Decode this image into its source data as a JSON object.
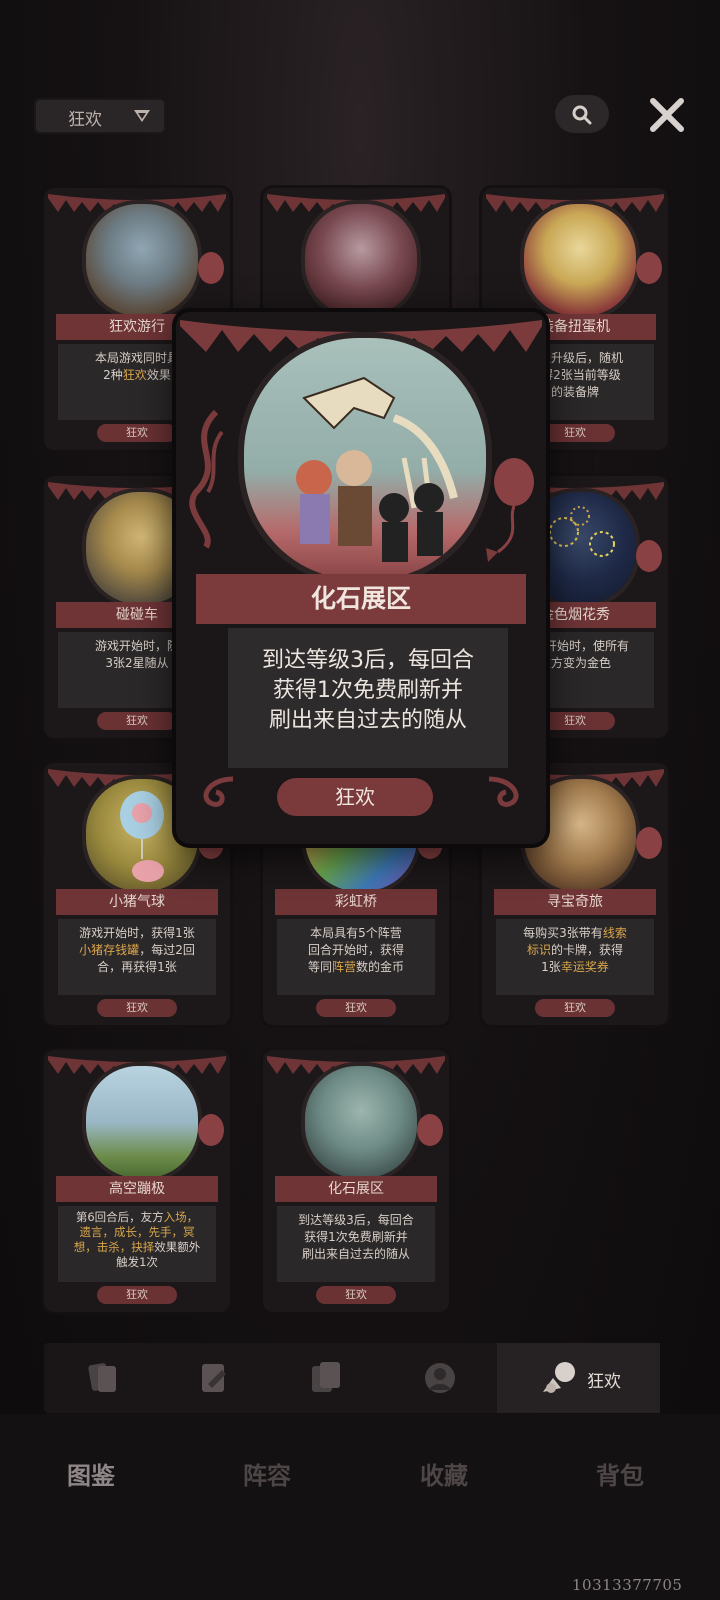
{
  "top_bar": {
    "filter_label": "狂欢"
  },
  "cards": [
    {
      "name": "狂欢游行",
      "desc": [
        "本局游戏同时具有",
        "2种",
        "狂欢",
        "效果"
      ],
      "tag": "狂欢"
    },
    {
      "name": "",
      "desc": [],
      "tag": ""
    },
    {
      "name": "装备扭蛋机",
      "desc": [
        "每次升级后，随机",
        "获得2张当前等级",
        "的装备牌"
      ],
      "tag": "狂欢"
    },
    {
      "name": "碰碰车",
      "desc": [
        "游戏开始时，随机",
        "3张2星随从"
      ],
      "tag": "狂欢"
    },
    {
      "name": "金色烟花秀",
      "desc": [
        "游戏开始时，使所有",
        "友方变为金色"
      ],
      "tag": "狂欢"
    },
    {
      "name": "小猪气球",
      "desc_parts": [
        "游戏开始时，获得1张",
        "小猪存钱罐",
        "，每过2回合，再获得1张"
      ],
      "tag": "狂欢"
    },
    {
      "name": "彩虹桥",
      "desc_parts": [
        "本局具有5个阵营",
        "回合开始时，获得",
        "等同",
        "阵营",
        "数的金币"
      ],
      "tag": "狂欢"
    },
    {
      "name": "寻宝奇旅",
      "desc_parts": [
        "每购买3张带有",
        "线索标识",
        "的卡牌，获得",
        "1张",
        "幸运奖券"
      ],
      "tag": "狂欢"
    },
    {
      "name": "高空蹦极",
      "desc_parts": [
        "第6回合后，友方",
        "入场、遗言、成长、先手、冥想、击杀、抉择",
        "效果额外触发1次"
      ],
      "tag": "狂欢"
    },
    {
      "name": "化石展区",
      "desc": [
        "到达等级3后，每回合",
        "获得1次免费刷新并",
        "刷出来自过去的随从"
      ],
      "tag": "狂欢"
    }
  ],
  "card_text": {
    "c1_line1": "本局游戏同时具",
    "c1_line2a": "2种",
    "c1_line2b": "狂欢",
    "c1_line2c": "效果",
    "c3_line1": "每次升级后，随机",
    "c3_line2": "获得2张当前等级",
    "c3_line3": "的装备牌",
    "c4_line1": "游戏开始时，随",
    "c4_line2": "3张2星随从",
    "c5_line1": "游戏开始时，使所有",
    "c5_line2": "友方变为金色",
    "c6_line1": "游戏开始时，获得1张",
    "c6_hl": "小猪存钱罐",
    "c6_line2b": "，每过2回",
    "c6_line3": "合，再获得1张",
    "c7_line1": "本局具有5个阵营",
    "c7_line2": "回合开始时，获得",
    "c7_line3a": "等同",
    "c7_hl": "阵营",
    "c7_line3b": "数的金币",
    "c8_line1a": "每购买3张带有",
    "c8_hl1": "线索",
    "c8_hl1b": "标识",
    "c8_line2b": "的卡牌，获得",
    "c8_line3a": "1张",
    "c8_hl2": "幸运奖券",
    "c9_line1a": "第6回合后，友方",
    "c9_hl1": "入场，",
    "c9_hl2": "遗言，成长，先手，冥",
    "c9_hl3": "想，击杀，抉择",
    "c9_line3b": "效果额外",
    "c9_line4": "触发1次",
    "c10_line1": "到达等级3后，每回合",
    "c10_line2": "获得1次免费刷新并",
    "c10_line3": "刷出来自过去的随从"
  },
  "popup": {
    "title": "化石展区",
    "desc_line1": "到达等级3后，每回合",
    "desc_line2": "获得1次免费刷新并",
    "desc_line3": "刷出来自过去的随从",
    "tag": "狂欢"
  },
  "category_bar": {
    "active_label": "狂欢"
  },
  "bottom_nav": {
    "items": [
      "图鉴",
      "阵容",
      "收藏",
      "背包"
    ]
  },
  "watermark": "10313377705",
  "colors": {
    "ribbon": "#6e3436",
    "highlight": "#d9a64c",
    "panel": "#2b2829"
  }
}
